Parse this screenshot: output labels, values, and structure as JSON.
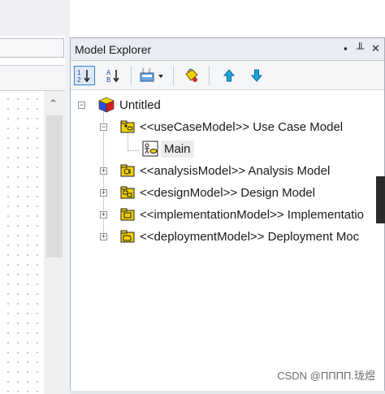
{
  "panel": {
    "title": "Model Explorer",
    "pin_glyph": "▪ ╬ ✕"
  },
  "toolbar": {
    "buttons": [
      {
        "icon": "sort-by-type-icon",
        "active": true
      },
      {
        "icon": "sort-alphabetical-icon",
        "active": false
      },
      {
        "icon": "filter-view-dropdown-icon",
        "active": false
      },
      {
        "icon": "show-stereotype-icon",
        "active": false
      },
      {
        "icon": "move-up-icon",
        "active": false
      },
      {
        "icon": "move-down-icon",
        "active": false
      }
    ]
  },
  "tree": {
    "root": "Untitled",
    "nodes": [
      {
        "label": "<<useCaseModel>> Use Case Model",
        "expanded": true
      },
      {
        "label": "Main"
      },
      {
        "label": "<<analysisModel>> Analysis Model",
        "expanded": false
      },
      {
        "label": "<<designModel>> Design Model",
        "expanded": false
      },
      {
        "label": "<<implementationModel>> Implementatio",
        "expanded": false
      },
      {
        "label": "<<deploymentModel>> Deployment Moc",
        "expanded": false
      }
    ]
  },
  "watermark": "CSDN @ΠΠΠΠ.珑煜",
  "colors": {
    "accent": "#3c7fd1",
    "folder_yellow": "#f2d000",
    "arrow_cyan": "#1aa6d9"
  }
}
